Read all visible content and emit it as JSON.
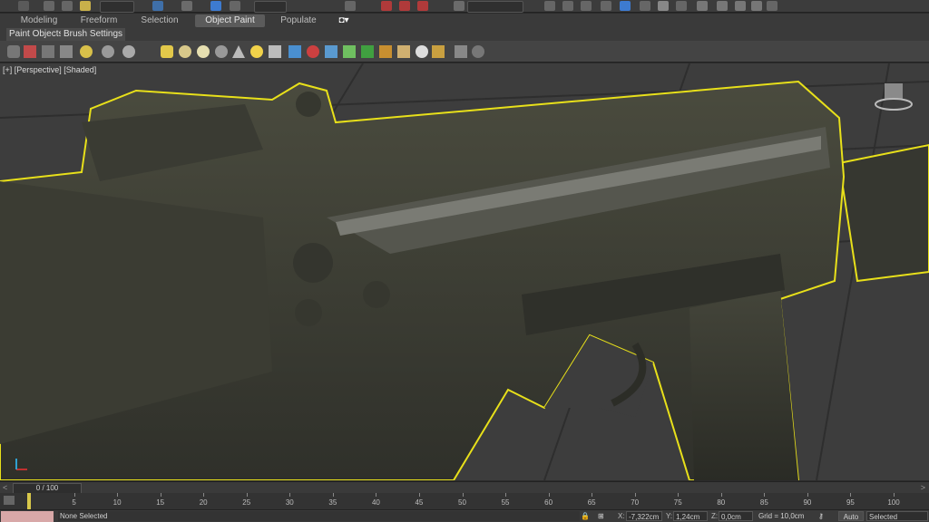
{
  "ribbon": {
    "tabs": [
      {
        "label": "Modeling"
      },
      {
        "label": "Freeform"
      },
      {
        "label": "Selection"
      },
      {
        "label": "Object Paint",
        "active": true
      },
      {
        "label": "Populate"
      }
    ],
    "subtabs": [
      "Paint Objects",
      "Brush Settings"
    ]
  },
  "viewport": {
    "label": "[+] [Perspective] [Shaded]",
    "selection_outline_color": "#e8e01a",
    "background_color": "#3f3f3f"
  },
  "timeline": {
    "frame_counter": "0 / 100",
    "ticks": [
      "5",
      "10",
      "15",
      "20",
      "25",
      "30",
      "35",
      "40",
      "45",
      "50",
      "55",
      "60",
      "65",
      "70",
      "75",
      "80",
      "85",
      "90",
      "95",
      "100"
    ]
  },
  "status": {
    "selection_text": "None Selected",
    "x_label": "X:",
    "x_value": "-7,322cm",
    "y_label": "Y:",
    "y_value": "1,24cm",
    "z_label": "Z:",
    "z_value": "0,0cm",
    "grid_text": "Grid = 10,0cm",
    "auto_label": "Auto",
    "selected_dropdown": "Selected"
  }
}
